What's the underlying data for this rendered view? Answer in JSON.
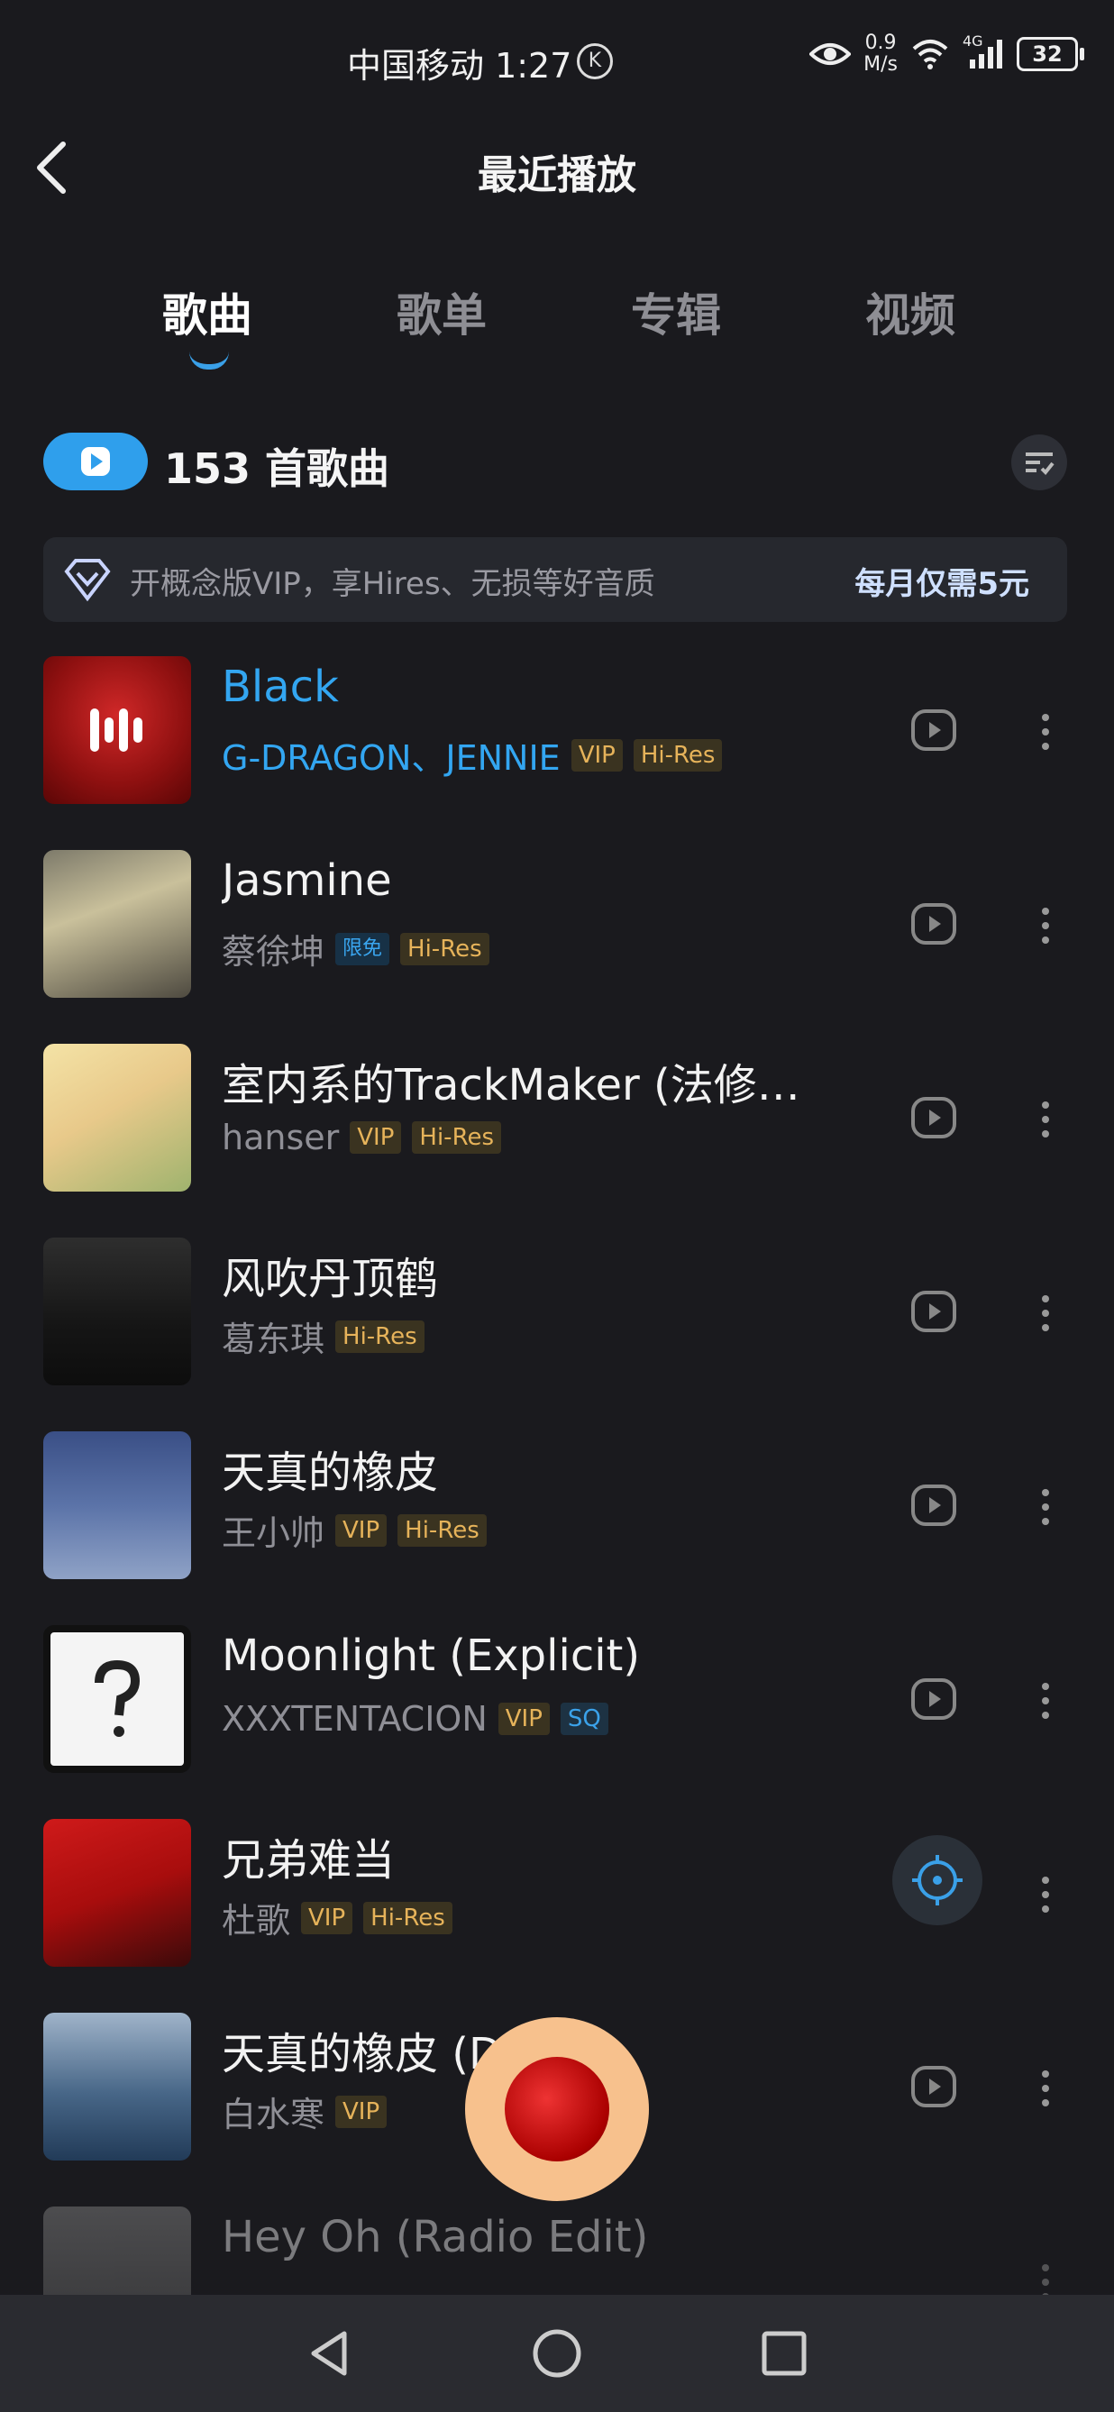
{
  "status_bar": {
    "carrier_time": "中国移动 1:27",
    "k_badge": "K",
    "net_speed_top": "0.9",
    "net_speed_bottom": "M/s",
    "signal_label": "4G",
    "battery": "32"
  },
  "header": {
    "title": "最近播放"
  },
  "tabs": [
    {
      "label": "歌曲",
      "active": true
    },
    {
      "label": "歌单",
      "active": false
    },
    {
      "label": "专辑",
      "active": false
    },
    {
      "label": "视频",
      "active": false
    }
  ],
  "summary": {
    "count_text": "153 首歌曲"
  },
  "vip_banner": {
    "text": "开概念版VIP，享Hires、无损等好音质",
    "price": "每月仅需5元"
  },
  "songs": [
    {
      "title": "Black",
      "artist": "G-DRAGON、JENNIE",
      "badges": [
        "VIP",
        "Hi-Res"
      ],
      "playing": true
    },
    {
      "title": "Jasmine",
      "artist": "蔡徐坤",
      "badges": [
        "限免",
        "Hi-Res"
      ]
    },
    {
      "title": "室内系的TrackMaker (法修散...",
      "artist": "hanser",
      "badges": [
        "VIP",
        "Hi-Res"
      ]
    },
    {
      "title": "风吹丹顶鹤",
      "artist": "葛东琪",
      "badges": [
        "Hi-Res"
      ]
    },
    {
      "title": "天真的橡皮",
      "artist": "王小帅",
      "badges": [
        "VIP",
        "Hi-Res"
      ]
    },
    {
      "title": "Moonlight (Explicit)",
      "artist": "XXXTENTACION",
      "badges": [
        "VIP",
        "SQ"
      ]
    },
    {
      "title": "兄弟难当",
      "artist": "杜歌",
      "badges": [
        "VIP",
        "Hi-Res"
      ]
    },
    {
      "title": "天真的橡皮 (D",
      "artist": "白水寒",
      "badges": [
        "VIP"
      ]
    },
    {
      "title": "Hey Oh (Radio Edit)",
      "artist": "",
      "badges": []
    }
  ],
  "colors": {
    "accent": "#2f9fec",
    "background": "#1a1a1e",
    "vip_gold": "#e6b35a"
  }
}
